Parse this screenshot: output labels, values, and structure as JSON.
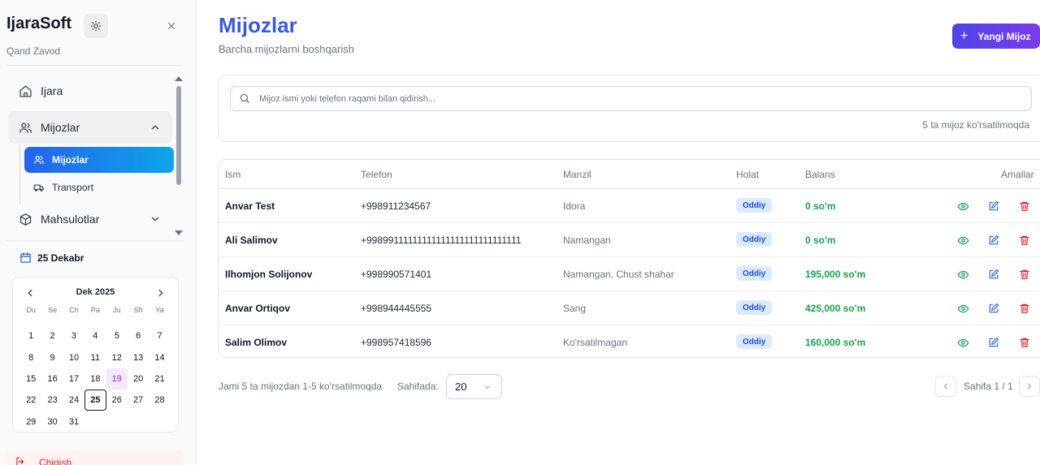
{
  "sidebar": {
    "brand": "IjaraSoft",
    "company": "Qand Zavod",
    "nav": {
      "ijara": "Ijara",
      "mijozlar": "Mijozlar",
      "mahsulotlar": "Mahsulotlar"
    },
    "sub": {
      "mijozlar": "Mijozlar",
      "transport": "Transport"
    },
    "date": "25 Dekabr",
    "calendar": {
      "month": "Dek 2025",
      "dow": [
        "Du",
        "Se",
        "Ch",
        "Pa",
        "Ju",
        "Sh",
        "Ya"
      ],
      "weeks": [
        [
          "1",
          "2",
          "3",
          "4",
          "5",
          "6",
          "7"
        ],
        [
          "8",
          "9",
          "10",
          "11",
          "12",
          "13",
          "14"
        ],
        [
          "15",
          "16",
          "17",
          "18",
          "19",
          "20",
          "21"
        ],
        [
          "22",
          "23",
          "24",
          "25",
          "26",
          "27",
          "28"
        ],
        [
          "29",
          "30",
          "31",
          "",
          "",
          "",
          ""
        ]
      ],
      "today": "19",
      "selected": "25"
    },
    "logout": "Chiqish"
  },
  "header": {
    "title": "Mijozlar",
    "subtitle": "Barcha mijozlarni boshqarish",
    "new_button": "Yangi Mijoz"
  },
  "search": {
    "placeholder": "Mijoz ismi yoki telefon raqami bilan qidirish...",
    "value": "",
    "count_text": "5 ta mijoz ko'rsatilmoqda"
  },
  "table": {
    "headers": {
      "name": "Ism",
      "phone": "Telefon",
      "address": "Manzil",
      "status": "Holat",
      "balance": "Balans",
      "actions": "Amallar"
    },
    "rows": [
      {
        "name": "Anvar Test",
        "phone": "+998911234567",
        "address": "Idora",
        "status": "Oddiy",
        "balance": "0 so'm"
      },
      {
        "name": "Ali Salimov",
        "phone": "+99899111111111111111111111111111",
        "address": "Namangan",
        "status": "Oddiy",
        "balance": "0 so'm"
      },
      {
        "name": "Ilhomjon Solijonov",
        "phone": "+998990571401",
        "address": "Namangan, Chust shahar",
        "status": "Oddiy",
        "balance": "195,000 so'm"
      },
      {
        "name": "Anvar Ortiqov",
        "phone": "+998944445555",
        "address": "Sang",
        "status": "Oddiy",
        "balance": "425,000 so'm"
      },
      {
        "name": "Salim Olimov",
        "phone": "+998957418596",
        "address": "Ko'rsatilmagan",
        "status": "Oddiy",
        "balance": "160,000 so'm"
      }
    ]
  },
  "footer": {
    "summary": "Jami 5 ta mijozdan 1-5 ko'rsatilmoqda",
    "per_page_label": "Sahifada:",
    "per_page_value": "20",
    "page_text": "Sahifa 1 / 1"
  },
  "icons": {
    "theme": "sun-icon",
    "close": "close-icon",
    "home": "home-icon",
    "users": "users-icon",
    "truck": "truck-icon",
    "box": "box-icon",
    "calendar": "calendar-icon",
    "logout": "logout-icon",
    "search": "search-icon",
    "view": "eye-icon",
    "edit": "edit-icon",
    "delete": "trash-icon"
  },
  "colors": {
    "title": "#3b5bdb",
    "active_nav": "#2563eb",
    "balance": "#16a34a",
    "badge_bg": "#dbeafe",
    "badge_text": "#1d4ed8",
    "view_icon": "#16a34a",
    "edit_icon": "#2563eb",
    "delete_icon": "#dc2626",
    "logout": "#dc2626"
  }
}
